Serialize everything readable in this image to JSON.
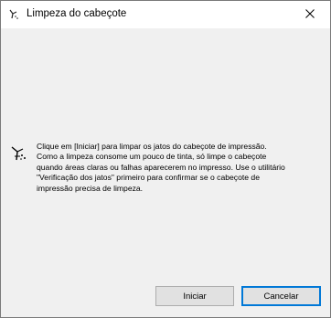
{
  "window": {
    "title": "Limpeza do cabeçote",
    "title_icon": "printer-head-icon",
    "close_icon": "close-icon"
  },
  "message": {
    "icon": "head-cleaning-icon",
    "text": "Clique em [Iniciar] para limpar os jatos do cabeçote de impressão.\nComo a limpeza consome um pouco de tinta, só limpe o cabeçote\nquando áreas claras ou falhas aparecerem no impresso. Use o utilitário\n\"Verificação dos jatos\" primeiro para confirmar se o cabeçote de\nimpressão precisa de limpeza."
  },
  "buttons": {
    "start_label": "Iniciar",
    "cancel_label": "Cancelar"
  },
  "colors": {
    "accent": "#0078d7",
    "dialog_bg": "#f0f0f0",
    "button_bg": "#e1e1e1"
  }
}
